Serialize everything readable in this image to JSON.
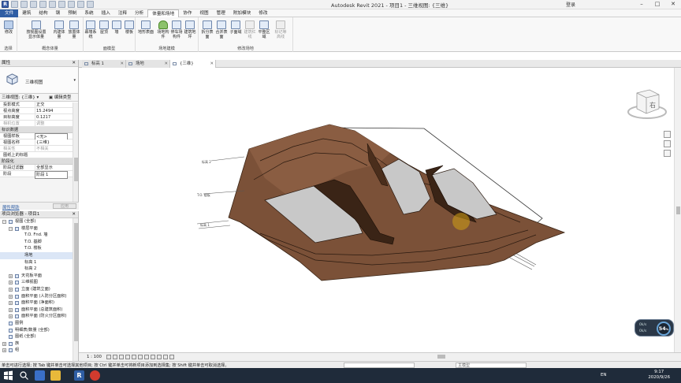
{
  "app": {
    "title": "Autodesk Revit 2021 - 项目1 - 三维视图: {三维}",
    "user": "登录"
  },
  "menu": {
    "items": [
      "文件",
      "建筑",
      "结构",
      "钢",
      "预制",
      "系统",
      "插入",
      "注释",
      "分析",
      "体量和场地",
      "协作",
      "视图",
      "管理",
      "附加模块",
      "修改"
    ],
    "active": "体量和场地"
  },
  "ribbon": {
    "select_label": "修改",
    "select_group": "选择",
    "conceptual_group": "概念体量",
    "conceptual": [
      "按视图设置显示体量",
      "内建体量",
      "放置体量"
    ],
    "face_group": "面模型",
    "face": [
      "幕墙系统",
      "屋顶",
      "墙",
      "楼板"
    ],
    "site_group": "场地建模",
    "site": [
      "地形表面",
      "场地构件",
      "停车场构件",
      "建筑地坪"
    ],
    "modify_group": "修改场地",
    "modify": [
      "拆分表面",
      "合并表面",
      "子面域",
      "建筑红线",
      "平整区域",
      "标记等高线"
    ]
  },
  "tabs": [
    "标高 1",
    "场地",
    "{三维}"
  ],
  "properties": {
    "title": "属性",
    "type_name": "三维视图",
    "filter": "三维视图: {三维}",
    "edit_type": "编辑类型",
    "rows1": [
      {
        "k": "投影模式",
        "v": "正交"
      },
      {
        "k": "视点高度",
        "v": "15.2494"
      },
      {
        "k": "目标高度",
        "v": "0.1217"
      },
      {
        "k": "相机位置",
        "v": "调整"
      }
    ],
    "section_identity": "标识数据",
    "rows2": [
      {
        "k": "视图样板",
        "v": "<无>"
      },
      {
        "k": "视图名称",
        "v": "{三维}"
      },
      {
        "k": "相关性",
        "v": "不相关"
      },
      {
        "k": "图纸上的标题",
        "v": ""
      }
    ],
    "section_phasing": "阶段化",
    "rows3": [
      {
        "k": "阶段过滤器",
        "v": "全部显示"
      },
      {
        "k": "阶段",
        "v": "阶段 1"
      }
    ],
    "help": "属性帮助",
    "apply": "应用"
  },
  "browser": {
    "title": "项目浏览器 - 项目1",
    "items": [
      {
        "lvl": 0,
        "t": "视图 (全部)",
        "toggle": "−"
      },
      {
        "lvl": 1,
        "t": "楼层平面",
        "toggle": "−"
      },
      {
        "lvl": 2,
        "t": "T.O. Fnd. 墙"
      },
      {
        "lvl": 2,
        "t": "T.O. 基脚"
      },
      {
        "lvl": 2,
        "t": "T.O. 楼板"
      },
      {
        "lvl": 2,
        "t": "场地"
      },
      {
        "lvl": 2,
        "t": "标高 1"
      },
      {
        "lvl": 2,
        "t": "标高 2"
      },
      {
        "lvl": 1,
        "t": "天花板平面",
        "toggle": "+"
      },
      {
        "lvl": 1,
        "t": "三维视图",
        "toggle": "+"
      },
      {
        "lvl": 1,
        "t": "立面 (建筑立面)",
        "toggle": "+"
      },
      {
        "lvl": 1,
        "t": "面积平面 (人防分区面积)",
        "toggle": "+"
      },
      {
        "lvl": 1,
        "t": "面积平面 (净面积)",
        "toggle": "+"
      },
      {
        "lvl": 1,
        "t": "面积平面 (总建筑面积)",
        "toggle": "+"
      },
      {
        "lvl": 1,
        "t": "面积平面 (防火分区面积)",
        "toggle": "+"
      },
      {
        "lvl": 0,
        "t": "图例"
      },
      {
        "lvl": 0,
        "t": "明细表/数量 (全部)"
      },
      {
        "lvl": 0,
        "t": "图纸 (全部)"
      },
      {
        "lvl": 0,
        "t": "族",
        "toggle": "+"
      },
      {
        "lvl": 0,
        "t": "组",
        "toggle": "+"
      }
    ]
  },
  "viewbar": {
    "scale": "1 : 100"
  },
  "statusbar": {
    "message": "单击可进行选择; 按 Tab 键并单击可选择其他项目; 按 Ctrl 键并单击可将新项目添加到选择集; 按 Shift 键并单击可取消选择。",
    "model": "主模型"
  },
  "viewcube": {
    "face": "右"
  },
  "navwheel": {
    "value": "54",
    "unit": "%",
    "line1": "0k/s",
    "line2": "0k/s"
  },
  "taskbar": {
    "lang": "EN",
    "time": "9:17",
    "date": "2020/9/26"
  },
  "colors": {
    "terrain": "#7b5138",
    "terrain_top": "#8a5d42",
    "pad": "#c8c8c8",
    "file_tab": "#2f5ea4"
  }
}
